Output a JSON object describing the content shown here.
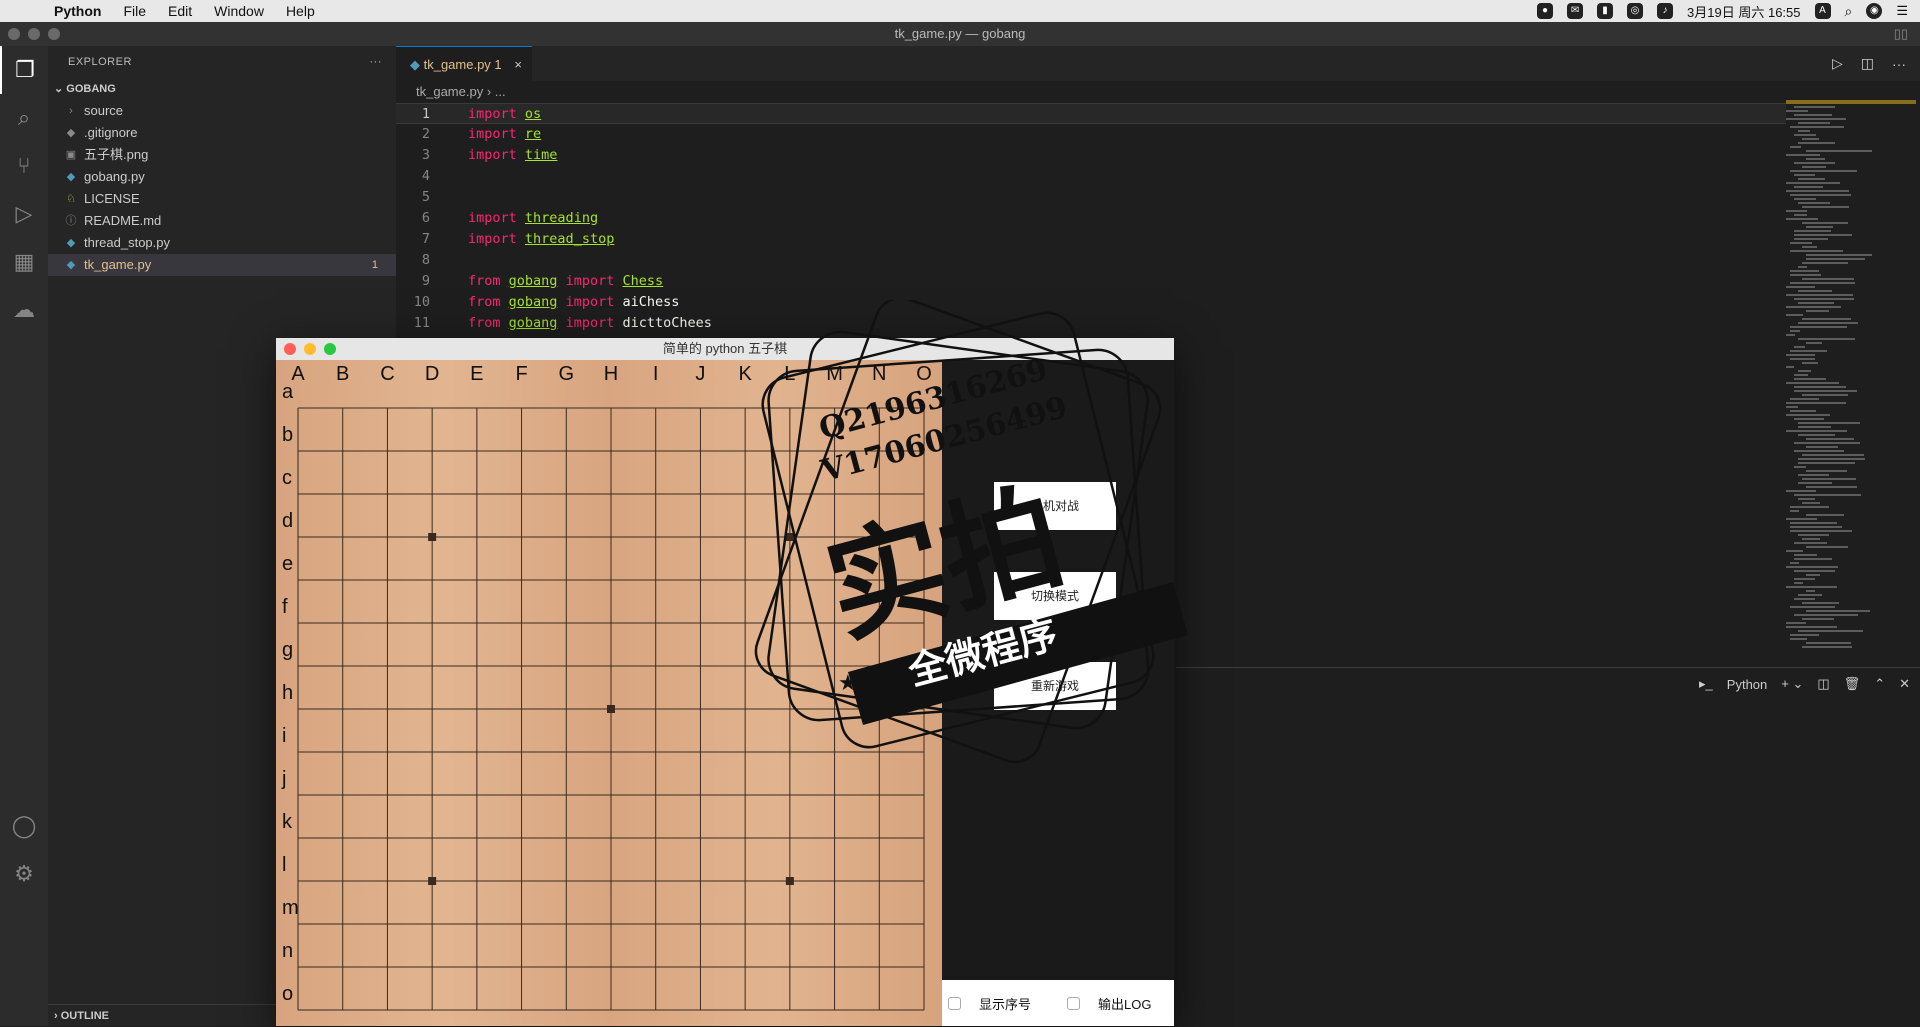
{
  "menubar": {
    "app": "Python",
    "items": [
      "File",
      "Edit",
      "Window",
      "Help"
    ],
    "clock": "3月19日 周六  16:55"
  },
  "window": {
    "title": "tk_game.py — gobang"
  },
  "explorer": {
    "header": "EXPLORER",
    "more": "···",
    "project": "GOBANG",
    "items": [
      {
        "label": "source",
        "icon": "chevron-right-icon",
        "glyph": "›"
      },
      {
        "label": ".gitignore",
        "icon": "gitignore-icon",
        "glyph": "◆"
      },
      {
        "label": "五子棋.png",
        "icon": "image-icon",
        "glyph": "▣"
      },
      {
        "label": "gobang.py",
        "icon": "python-icon",
        "glyph": "◆"
      },
      {
        "label": "LICENSE",
        "icon": "license-icon",
        "glyph": "♘"
      },
      {
        "label": "README.md",
        "icon": "info-icon",
        "glyph": "ⓘ"
      },
      {
        "label": "thread_stop.py",
        "icon": "python-icon",
        "glyph": "◆"
      },
      {
        "label": "tk_game.py",
        "icon": "python-icon",
        "glyph": "◆",
        "badge": "1",
        "selected": true
      }
    ],
    "outline": "OUTLINE"
  },
  "editor": {
    "tab": {
      "label": "tk_game.py 1",
      "close": "×"
    },
    "breadcrumb": "tk_game.py  ›  ...",
    "lines": [
      {
        "n": "1",
        "tokens": [
          [
            "kw",
            "import"
          ],
          [
            "sp",
            " "
          ],
          [
            "mod",
            "os"
          ]
        ]
      },
      {
        "n": "2",
        "tokens": [
          [
            "kw",
            "import"
          ],
          [
            "sp",
            " "
          ],
          [
            "mod",
            "re"
          ]
        ]
      },
      {
        "n": "3",
        "tokens": [
          [
            "kw",
            "import"
          ],
          [
            "sp",
            " "
          ],
          [
            "mod",
            "time"
          ]
        ]
      },
      {
        "n": "4",
        "tokens": []
      },
      {
        "n": "5",
        "tokens": []
      },
      {
        "n": "6",
        "tokens": [
          [
            "kw",
            "import"
          ],
          [
            "sp",
            " "
          ],
          [
            "mod",
            "threading"
          ]
        ]
      },
      {
        "n": "7",
        "tokens": [
          [
            "kw",
            "import"
          ],
          [
            "sp",
            " "
          ],
          [
            "mod",
            "thread_stop"
          ]
        ]
      },
      {
        "n": "8",
        "tokens": []
      },
      {
        "n": "9",
        "tokens": [
          [
            "kw",
            "from"
          ],
          [
            "sp",
            " "
          ],
          [
            "mod",
            "gobang"
          ],
          [
            "sp",
            " "
          ],
          [
            "kw",
            "import"
          ],
          [
            "sp",
            " "
          ],
          [
            "mod",
            "Chess"
          ]
        ]
      },
      {
        "n": "10",
        "tokens": [
          [
            "kw",
            "from"
          ],
          [
            "sp",
            " "
          ],
          [
            "mod",
            "gobang"
          ],
          [
            "sp",
            " "
          ],
          [
            "kw",
            "import"
          ],
          [
            "sp",
            " "
          ],
          [
            "idn",
            "aiChess"
          ]
        ]
      },
      {
        "n": "11",
        "tokens": [
          [
            "kw",
            "from"
          ],
          [
            "sp",
            " "
          ],
          [
            "mod",
            "gobang"
          ],
          [
            "sp",
            " "
          ],
          [
            "kw",
            "import"
          ],
          [
            "sp",
            " "
          ],
          [
            "idn",
            "dicttoChees"
          ]
        ]
      }
    ]
  },
  "panel": {
    "terminal_label": "Python"
  },
  "game": {
    "title": "简单的 python 五子棋",
    "columns": [
      "A",
      "B",
      "C",
      "D",
      "E",
      "F",
      "G",
      "H",
      "I",
      "J",
      "K",
      "L",
      "M",
      "N",
      "O"
    ],
    "rows": [
      "a",
      "b",
      "c",
      "d",
      "e",
      "f",
      "g",
      "h",
      "i",
      "j",
      "k",
      "l",
      "m",
      "n",
      "o"
    ],
    "buttons": [
      "人机对战",
      "切换模式",
      "重新游戏"
    ],
    "show_index_label": "显示序号",
    "output_log_label": "输出LOG"
  },
  "watermark": {
    "contact_q": "Q2196316269",
    "contact_v": "V17060256499",
    "big": "实拍",
    "banner": "全微程序"
  },
  "colors": {
    "accent": "#0078d4",
    "modified": "#e2c08d",
    "keyword": "#f92672",
    "module": "#a6e22e"
  }
}
